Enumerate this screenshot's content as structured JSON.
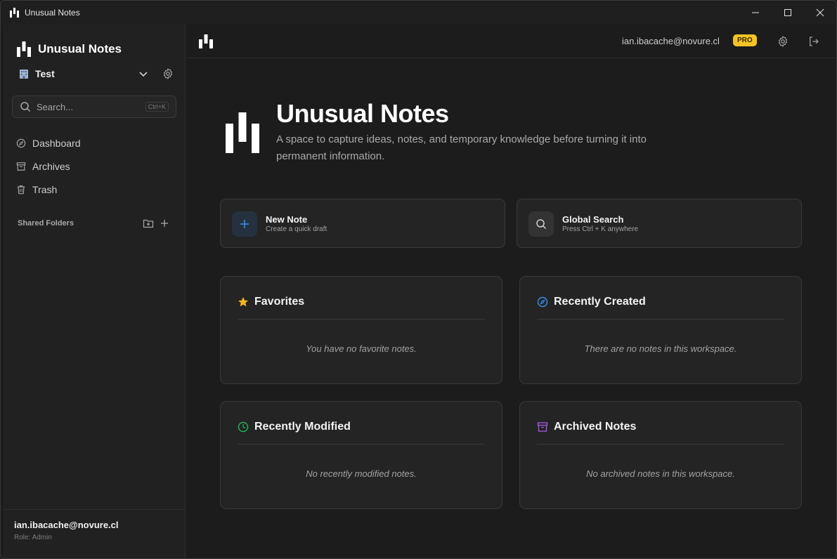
{
  "window": {
    "title": "Unusual Notes"
  },
  "sidebar": {
    "app_name": "Unusual Notes",
    "workspace": "Test",
    "search": {
      "placeholder": "Search...",
      "shortcut": "Ctrl+K"
    },
    "nav": [
      {
        "label": "Dashboard",
        "icon": "compass-icon"
      },
      {
        "label": "Archives",
        "icon": "archive-icon"
      },
      {
        "label": "Trash",
        "icon": "trash-icon"
      }
    ],
    "shared_folders_label": "Shared Folders",
    "user": {
      "email": "ian.ibacache@novure.cl",
      "role": "Role: Admin"
    }
  },
  "topbar": {
    "email": "ian.ibacache@novure.cl",
    "badge": "PRO"
  },
  "hero": {
    "title": "Unusual Notes",
    "subtitle": "A space to capture ideas, notes, and temporary knowledge before turning it into permanent information."
  },
  "actions": [
    {
      "title": "New Note",
      "subtitle": "Create a quick draft",
      "icon": "plus-icon"
    },
    {
      "title": "Global Search",
      "subtitle": "Press Ctrl + K anywhere",
      "icon": "search-icon"
    }
  ],
  "cards": [
    {
      "title": "Favorites",
      "empty": "You have no favorite notes.",
      "icon": "star-icon",
      "color": "#f5b324"
    },
    {
      "title": "Recently Created",
      "empty": "There are no notes in this workspace.",
      "icon": "compass-icon",
      "color": "#3b8ef0"
    },
    {
      "title": "Recently Modified",
      "empty": "No recently modified notes.",
      "icon": "clock-icon",
      "color": "#22b45e"
    },
    {
      "title": "Archived Notes",
      "empty": "No archived notes in this workspace.",
      "icon": "archive-icon",
      "color": "#a35ce0"
    }
  ],
  "colors": {
    "accent": "#3b8ef0",
    "pro_badge": "#f5c324",
    "background": "#1c1c1c",
    "sidebar": "#212121"
  }
}
